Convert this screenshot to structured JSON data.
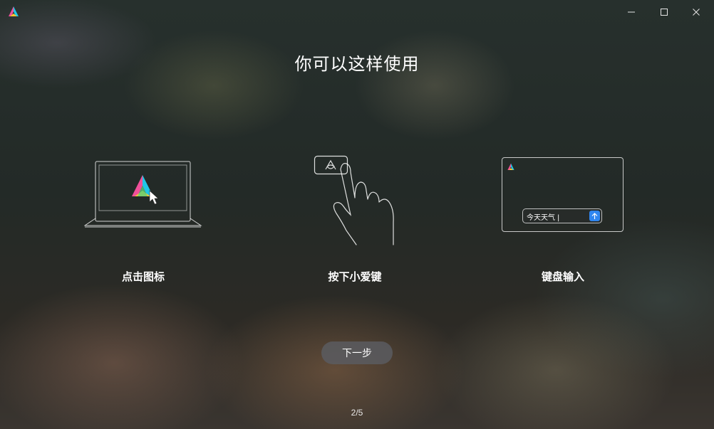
{
  "window": {
    "controls": [
      "minimize-icon",
      "maximize-icon",
      "close-icon"
    ]
  },
  "main": {
    "title": "你可以这样使用",
    "methods": [
      {
        "label": "点击图标",
        "illustration": "laptop-with-logo-icon"
      },
      {
        "label": "按下小爱键",
        "illustration": "finger-pressing-key-icon"
      },
      {
        "label": "键盘输入",
        "illustration": "text-input-card-icon"
      }
    ],
    "keyboard_demo": {
      "input_text": "今天天气"
    },
    "next_button": "下一步",
    "page_indicator": "2/5"
  },
  "colors": {
    "accent_blue": "#2f86f0",
    "logo_pink": "#f0509a",
    "logo_cyan": "#20c6e6",
    "logo_yellow": "#f6c430"
  }
}
